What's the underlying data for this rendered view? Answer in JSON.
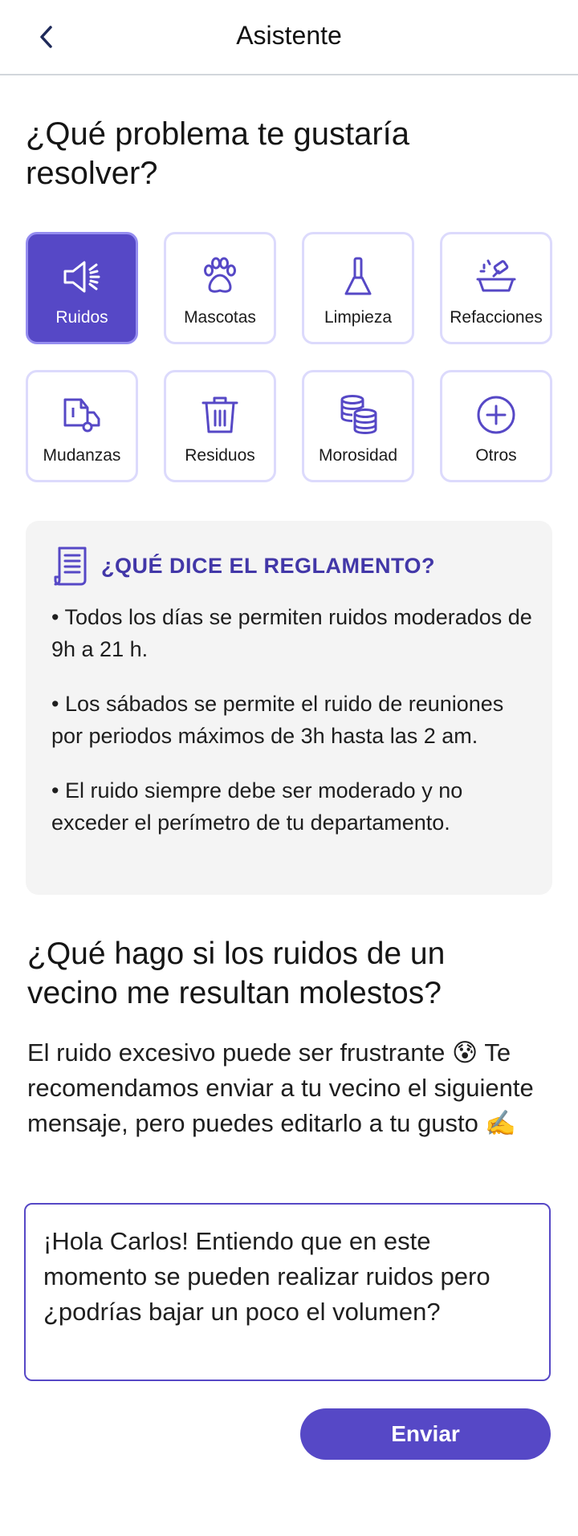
{
  "header": {
    "title": "Asistente"
  },
  "question": {
    "title": "¿Qué problema te gustaría resolver?"
  },
  "categories": [
    {
      "label": "Ruidos",
      "icon": "speaker-icon",
      "selected": true
    },
    {
      "label": "Mascotas",
      "icon": "paw-icon",
      "selected": false
    },
    {
      "label": "Limpieza",
      "icon": "broom-icon",
      "selected": false
    },
    {
      "label": "Refacciones",
      "icon": "repair-icon",
      "selected": false
    },
    {
      "label": "Mudanzas",
      "icon": "moving-truck-icon",
      "selected": false
    },
    {
      "label": "Residuos",
      "icon": "trash-icon",
      "selected": false
    },
    {
      "label": "Morosidad",
      "icon": "coins-icon",
      "selected": false
    },
    {
      "label": "Otros",
      "icon": "plus-circle-icon",
      "selected": false
    }
  ],
  "rules": {
    "heading": "¿QUÉ DICE EL REGLAMENTO?",
    "items": [
      "• Todos los días se permiten ruidos moderados de 9h a 21 h.",
      "• Los sábados se permite el ruido de reuniones por periodos máximos de 3h hasta las 2 am.",
      "• El ruido siempre debe ser moderado y no exceder el perímetro de tu departamento."
    ]
  },
  "help": {
    "title": "¿Qué hago si los ruidos de un vecino me resultan molestos?",
    "advice": "El ruido excesivo puede ser frustrante 😰 Te recomendamos enviar a tu vecino el siguiente mensaje, pero puedes editarlo a tu gusto ✍️"
  },
  "message": {
    "text": "¡Hola Carlos! Entiendo que en este momento se pueden realizar ruidos pero ¿podrías bajar un poco el volumen?"
  },
  "actions": {
    "send_label": "Enviar"
  },
  "colors": {
    "accent": "#5648c6",
    "accent_border": "#958df0",
    "tile_border": "#dcdafc",
    "heading_accent": "#4237a8",
    "card_bg": "#f4f4f4"
  }
}
